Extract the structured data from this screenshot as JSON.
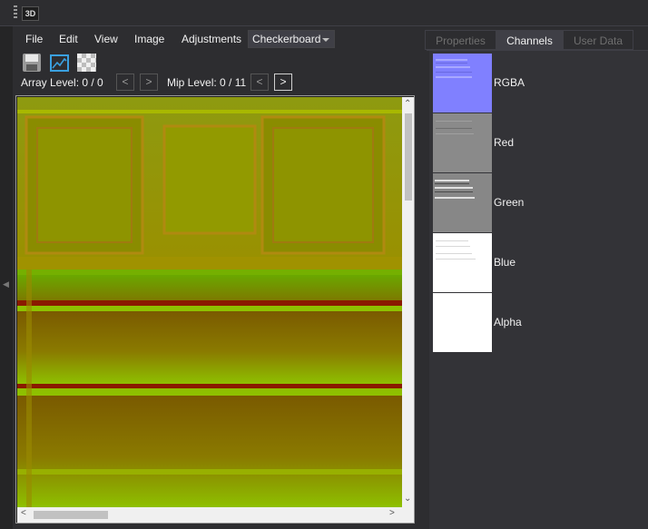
{
  "app": {
    "icon_text": "3D"
  },
  "menu": [
    "File",
    "Edit",
    "View",
    "Image",
    "Adjustments"
  ],
  "view_mode": {
    "selected": "Checkerboard"
  },
  "toolbar": {
    "icons": [
      "save-icon",
      "image-icon",
      "checkerboard-icon"
    ]
  },
  "levels": {
    "array_label": "Array Level: 0 / 0",
    "mip_label": "Mip Level: 0 / 11",
    "prev": "<",
    "next": ">"
  },
  "tabs": [
    {
      "label": "Properties",
      "active": false
    },
    {
      "label": "Channels",
      "active": true
    },
    {
      "label": "User Data",
      "active": false
    }
  ],
  "channels": [
    "RGBA",
    "Red",
    "Green",
    "Blue",
    "Alpha"
  ],
  "colors": {
    "accent_blue": "#3aa0e0",
    "rgba_thumb": "#8080ff",
    "texture_green": "#8ec000",
    "texture_brown": "#7a5a00",
    "stripe_red": "#8a1a00"
  }
}
